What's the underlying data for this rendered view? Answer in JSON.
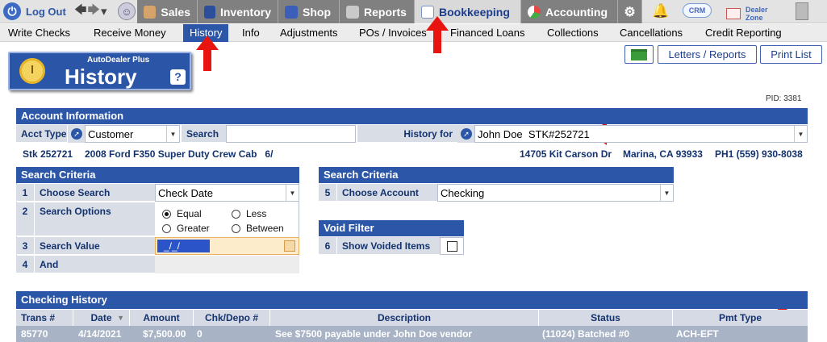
{
  "topnav": {
    "logout": "Log Out",
    "tabs": [
      {
        "label": "Sales",
        "icon": "salesperson-icon"
      },
      {
        "label": "Inventory",
        "icon": "car-icon"
      },
      {
        "label": "Shop",
        "icon": "wrench-icon"
      },
      {
        "label": "Reports",
        "icon": "report-icon"
      },
      {
        "label": "Bookkeeping",
        "icon": "book-icon",
        "active": true
      },
      {
        "label": "Accounting",
        "icon": "pie-chart-icon"
      }
    ],
    "crm": "CRM",
    "dealer_zone_line1": "Dealer",
    "dealer_zone_line2": "Zone"
  },
  "submenu": [
    {
      "label": "Write Checks"
    },
    {
      "label": "Receive Money"
    },
    {
      "label": "History",
      "active": true
    },
    {
      "label": "Info"
    },
    {
      "label": "Adjustments"
    },
    {
      "label": "POs / Invoices"
    },
    {
      "label": "Financed Loans"
    },
    {
      "label": "Collections"
    },
    {
      "label": "Cancellations"
    },
    {
      "label": "Credit Reporting"
    }
  ],
  "page": {
    "brand": "AutoDealer Plus",
    "title": "History",
    "help": "?",
    "pid": "PID: 3381"
  },
  "actions": {
    "letters": "Letters / Reports",
    "print": "Print List"
  },
  "account": {
    "header": "Account Information",
    "acct_type_label": "Acct Type",
    "acct_type_value": "Customer",
    "search_label": "Search",
    "search_value": "",
    "history_for_label": "History for",
    "history_for_value": "John Doe  STK#252721",
    "stock": "Stk 252721",
    "vehicle": "2008 Ford F350 Super Duty Crew Cab   6/",
    "address": "14705 Kit Carson Dr",
    "city": "Marina, CA 93933",
    "phone": "PH1 (559) 930-8038"
  },
  "search_criteria_left": {
    "header": "Search Criteria",
    "rows": [
      {
        "num": "1",
        "label": "Choose Search",
        "value": "Check Date"
      },
      {
        "num": "2",
        "label": "Search Options"
      },
      {
        "num": "3",
        "label": "Search Value",
        "value": "_/_/"
      },
      {
        "num": "4",
        "label": "And"
      }
    ],
    "options": [
      "Equal",
      "Less",
      "Greater",
      "Between"
    ],
    "selected_option": "Equal"
  },
  "search_criteria_right": {
    "header": "Search Criteria",
    "num": "5",
    "label": "Choose Account",
    "value": "Checking"
  },
  "void_filter": {
    "header": "Void Filter",
    "num": "6",
    "label": "Show Voided Items",
    "checked": false
  },
  "history_table": {
    "header": "Checking History",
    "columns": [
      "Trans #",
      "Date",
      "Amount",
      "Chk/Depo #",
      "Description",
      "Status",
      "Pmt Type"
    ],
    "rows": [
      {
        "trans": "85770",
        "date": "4/14/2021",
        "amount": "$7,500.00",
        "chk": "0",
        "description": "See $7500 payable under John Doe vendor",
        "status": "(11024) Batched #0",
        "pmt_type": "ACH-EFT"
      }
    ]
  },
  "colors": {
    "primary_blue": "#2c56a8",
    "nav_gray": "#808080",
    "annotation_red": "#e8140f",
    "label_bg": "#d9dde6"
  }
}
